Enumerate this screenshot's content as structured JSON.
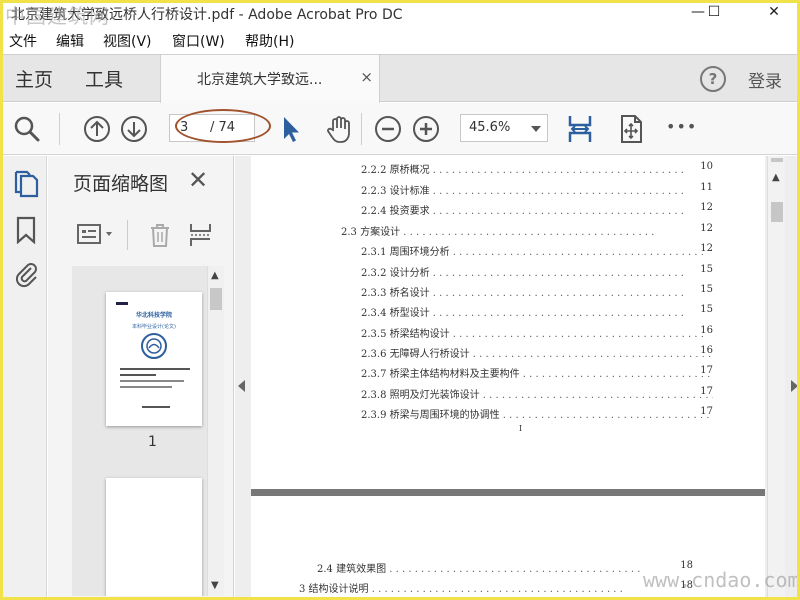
{
  "window": {
    "title": "北京建筑大学致远桥人行桥设计.pdf - Adobe Acrobat Pro DC",
    "watermark_top": "中国建筑网",
    "minimize": "—",
    "maximize": "☐",
    "close": "✕"
  },
  "menu": [
    "文件",
    "编辑",
    "视图(V)",
    "窗口(W)",
    "帮助(H)"
  ],
  "tabs": {
    "home": "主页",
    "tools": "工具",
    "document": "北京建筑大学致远...",
    "close": "×",
    "help": "?",
    "login": "登录"
  },
  "toolbar": {
    "current_page": "3",
    "total_pages": "/ 74",
    "zoom": "45.6%",
    "more": "•••",
    "icons": [
      "search-icon",
      "page-up-icon",
      "page-down-icon",
      "select-arrow-icon",
      "hand-icon",
      "zoom-out-icon",
      "zoom-in-icon",
      "fit-width-icon",
      "full-screen-icon",
      "more-icon"
    ]
  },
  "sidebar": {
    "icons": [
      "pages-icon",
      "bookmark-icon",
      "attachment-icon"
    ]
  },
  "thumbnails": {
    "title": "页面缩略图",
    "close": "✕",
    "page_label": "1",
    "thumb_heading": "华北科技学院",
    "thumb_subtitle": "本科毕业设计(论文)"
  },
  "toc_page1": [
    {
      "label": "2.2.2 原桥概况",
      "page": "10",
      "indent": 2
    },
    {
      "label": "2.2.3 设计标准",
      "page": "11",
      "indent": 2
    },
    {
      "label": "2.2.4 投资要求",
      "page": "12",
      "indent": 2
    },
    {
      "label": "2.3 方案设计",
      "page": "12",
      "indent": 1
    },
    {
      "label": "2.3.1 周围环境分析",
      "page": "12",
      "indent": 2
    },
    {
      "label": "2.3.2 设计分析",
      "page": "15",
      "indent": 2
    },
    {
      "label": "2.3.3 桥名设计",
      "page": "15",
      "indent": 2
    },
    {
      "label": "2.3.4 桥型设计",
      "page": "15",
      "indent": 2
    },
    {
      "label": "2.3.5 桥梁结构设计",
      "page": "16",
      "indent": 2
    },
    {
      "label": "2.3.6 无障碍人行桥设计",
      "page": "16",
      "indent": 2
    },
    {
      "label": "2.3.7 桥梁主体结构材料及主要构件",
      "page": "17",
      "indent": 2
    },
    {
      "label": "2.3.8 照明及灯光装饰设计",
      "page": "17",
      "indent": 2
    },
    {
      "label": "2.3.9 桥梁与周围环境的协调性",
      "page": "17",
      "indent": 2
    }
  ],
  "page1_footer": "I",
  "toc_page2": [
    {
      "label": "2.4 建筑效果图",
      "page": "18"
    },
    {
      "label": "3 结构设计说明",
      "page": "18"
    }
  ],
  "watermark_bottom": "www.cndao.com",
  "colors": {
    "accent_blue": "#2d5f9e",
    "annotation_ellipse": "#a0522d",
    "border_yellow": "#f2e24a"
  }
}
